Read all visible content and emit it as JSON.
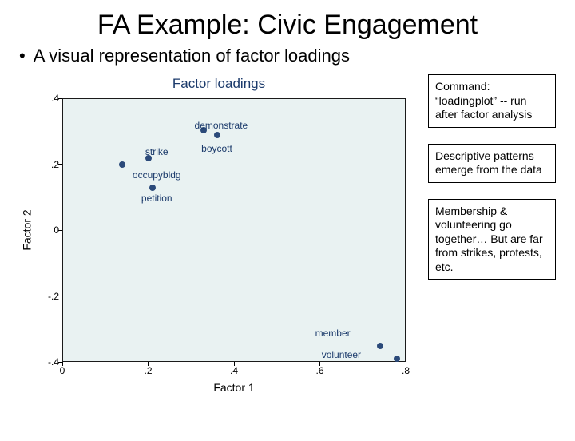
{
  "title": "FA Example:  Civic Engagement",
  "bullet": "A visual representation of factor loadings",
  "side_boxes": [
    "Command: “loadingplot” -- run after factor analysis",
    "Descriptive patterns emerge from the data",
    "Membership & volunteering go together… But are far from strikes, protests, etc."
  ],
  "chart_data": {
    "type": "scatter",
    "title": "Factor loadings",
    "xlabel": "Factor 1",
    "ylabel": "Factor 2",
    "xlim": [
      0,
      0.8
    ],
    "ylim": [
      -0.4,
      0.4
    ],
    "xticks": [
      0,
      0.2,
      0.4,
      0.6,
      0.8
    ],
    "yticks": [
      -0.4,
      -0.2,
      0,
      0.2,
      0.4
    ],
    "xtick_labels": [
      "0",
      ".2",
      ".4",
      ".6",
      ".8"
    ],
    "ytick_labels": [
      "-.4",
      "-.2",
      "0",
      ".2",
      ".4"
    ],
    "points": [
      {
        "label": "demonstrate",
        "x": 0.33,
        "y": 0.305,
        "lx": 0.37,
        "ly": 0.32
      },
      {
        "label": "boycott",
        "x": 0.36,
        "y": 0.29,
        "lx": 0.36,
        "ly": 0.25
      },
      {
        "label": "strike",
        "x": 0.2,
        "y": 0.22,
        "lx": 0.22,
        "ly": 0.24
      },
      {
        "label": "occupybldg",
        "x": 0.14,
        "y": 0.2,
        "lx": 0.22,
        "ly": 0.17
      },
      {
        "label": "petition",
        "x": 0.21,
        "y": 0.13,
        "lx": 0.22,
        "ly": 0.1
      },
      {
        "label": "member",
        "x": 0.74,
        "y": -0.35,
        "lx": 0.63,
        "ly": -0.31
      },
      {
        "label": "volunteer",
        "x": 0.78,
        "y": -0.39,
        "lx": 0.65,
        "ly": -0.375
      }
    ]
  }
}
